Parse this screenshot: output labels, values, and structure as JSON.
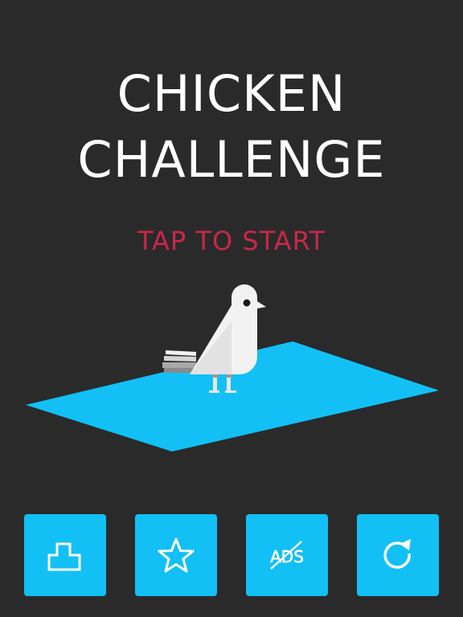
{
  "title": {
    "line1": "CHICKEN",
    "line2": "CHALLENGE"
  },
  "prompt": "TAP TO START",
  "colors": {
    "background": "#2a2a2a",
    "title": "#ffffff",
    "prompt": "#c8284a",
    "platform": "#12c0f5",
    "button": "#12c0f5"
  },
  "buttons": [
    {
      "icon": "leaderboard-icon"
    },
    {
      "icon": "star-icon"
    },
    {
      "icon": "no-ads-icon",
      "label": "ADS"
    },
    {
      "icon": "restart-icon"
    }
  ]
}
